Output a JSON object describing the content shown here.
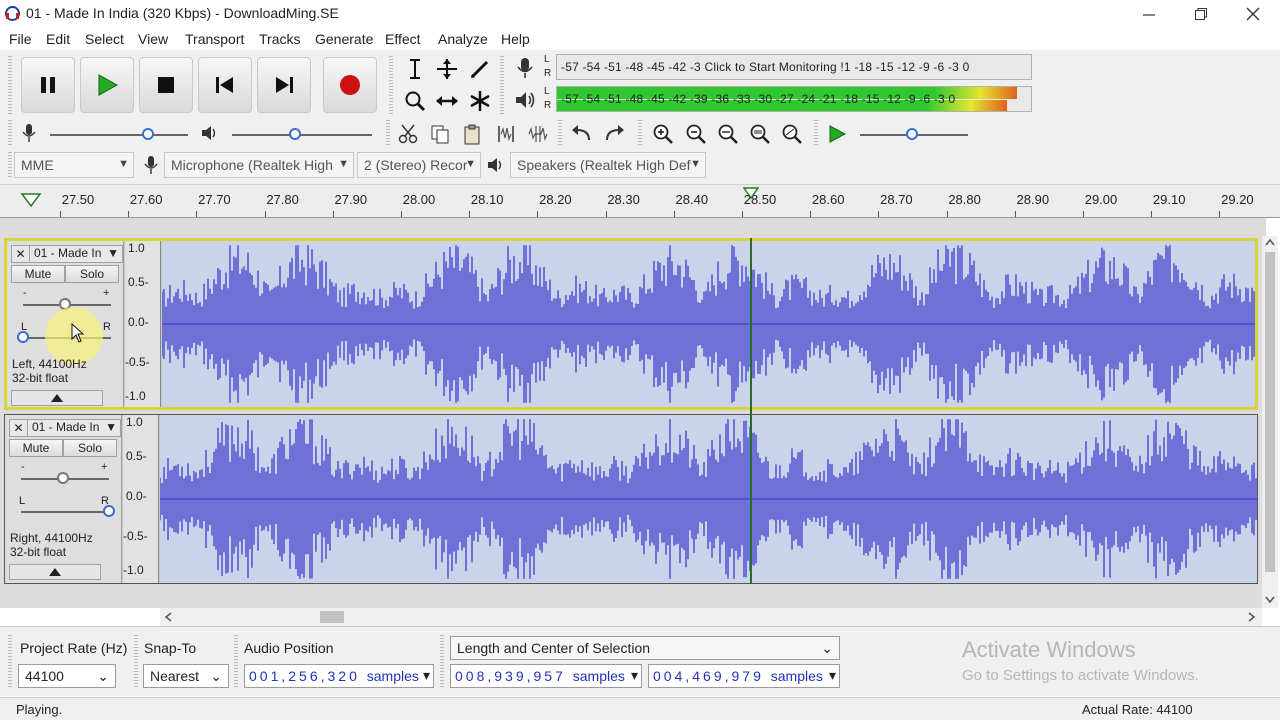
{
  "window": {
    "title": "01 - Made In India (320 Kbps) - DownloadMing.SE",
    "icons": [
      "app-icon",
      "minimize-icon",
      "restore-icon",
      "close-icon"
    ]
  },
  "menu": [
    "File",
    "Edit",
    "Select",
    "View",
    "Transport",
    "Tracks",
    "Generate",
    "Effect",
    "Analyze",
    "Help"
  ],
  "transport": {
    "buttons": [
      "pause-icon",
      "play-icon",
      "stop-icon",
      "skip-start-icon",
      "skip-end-icon",
      "record-icon"
    ],
    "accent": "#22aa22",
    "record_color": "#cc1111"
  },
  "meters": {
    "record_scale": "-57 -54 -51 -48 -45 -42 -3 Click to Start Monitoring !1 -18 -15 -12 -9 -6 -3 0",
    "playback_scale": "-57 -54 -51 -48 -45 -42 -39 -36 -33 -30 -27 -24 -21 -18 -15 -12 -9 -6 -3 0",
    "channel_l": "L",
    "channel_r": "R",
    "playback_level_left": 0.97,
    "playback_level_right": 0.95,
    "meter_color": "#2fc82f"
  },
  "device": {
    "host": "MME",
    "input": "Microphone (Realtek High",
    "channels": "2 (Stereo) Recor",
    "output": "Speakers (Realtek High Def"
  },
  "ruler": {
    "ticks": [
      "27.50",
      "27.60",
      "27.70",
      "27.80",
      "27.90",
      "28.00",
      "28.10",
      "28.20",
      "28.30",
      "28.40",
      "28.50",
      "28.60",
      "28.70",
      "28.80",
      "28.90",
      "29.00",
      "29.10",
      "29.20"
    ]
  },
  "tracks": [
    {
      "name": "01 - Made In",
      "mute": "Mute",
      "solo": "Solo",
      "pan_l": "L",
      "pan_r": "R",
      "gain_minus": "-",
      "gain_plus": "+",
      "rate": "Left, 44100Hz",
      "format": "32-bit float",
      "scale": [
        "1.0",
        "0.5-",
        "0.0-",
        "-0.5-",
        "-1.0"
      ],
      "selected": true,
      "pan": -1.0
    },
    {
      "name": "01 - Made In",
      "mute": "Mute",
      "solo": "Solo",
      "pan_l": "L",
      "pan_r": "R",
      "gain_minus": "-",
      "gain_plus": "+",
      "rate": "Right, 44100Hz",
      "format": "32-bit float",
      "scale": [
        "1.0",
        "0.5-",
        "0.0-",
        "-0.5-",
        "-1.0"
      ],
      "selected": false,
      "pan": 1.0
    }
  ],
  "waveform_color": "#3232c8",
  "selection_bar": {
    "project_rate_label": "Project Rate (Hz)",
    "project_rate": "44100",
    "snap_label": "Snap-To",
    "snap_value": "Nearest",
    "audio_position_label": "Audio Position",
    "audio_position": "001,256,320",
    "selection_mode": "Length and Center of Selection",
    "length": "008,939,957",
    "center": "004,469,979",
    "unit": "samples"
  },
  "watermark": {
    "line1": "Activate Windows",
    "line2": "Go to Settings to activate Windows."
  },
  "status": {
    "state": "Playing.",
    "actual_rate": "Actual Rate: 44100"
  }
}
